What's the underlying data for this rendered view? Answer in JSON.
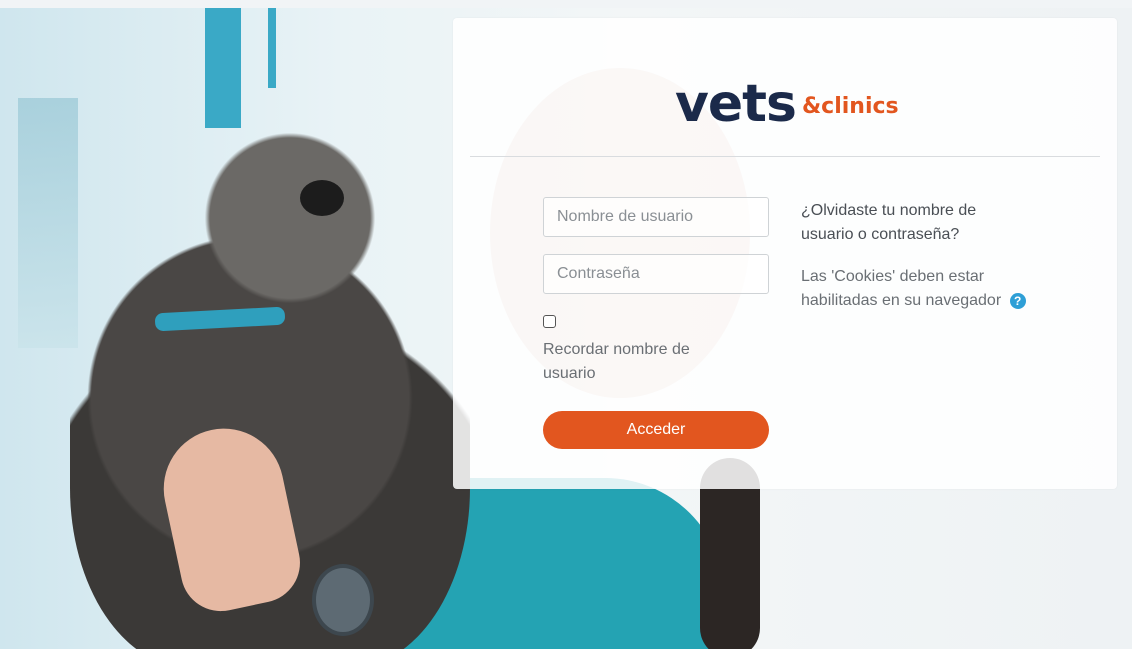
{
  "brand": {
    "name_main": "vets",
    "name_sub": "&clinics"
  },
  "login": {
    "username_placeholder": "Nombre de usuario",
    "password_placeholder": "Contraseña",
    "remember_label": "Recordar nombre de usuario",
    "submit_label": "Acceder",
    "forgot_link": "¿Olvidaste tu nombre de usuario o contraseña?",
    "cookies_notice": "Las 'Cookies' deben estar habilitadas en su navegador",
    "help_icon": "?"
  },
  "colors": {
    "accent": "#e2561f",
    "brand_dark": "#1b2a4a",
    "help_blue": "#2e9fd6"
  }
}
